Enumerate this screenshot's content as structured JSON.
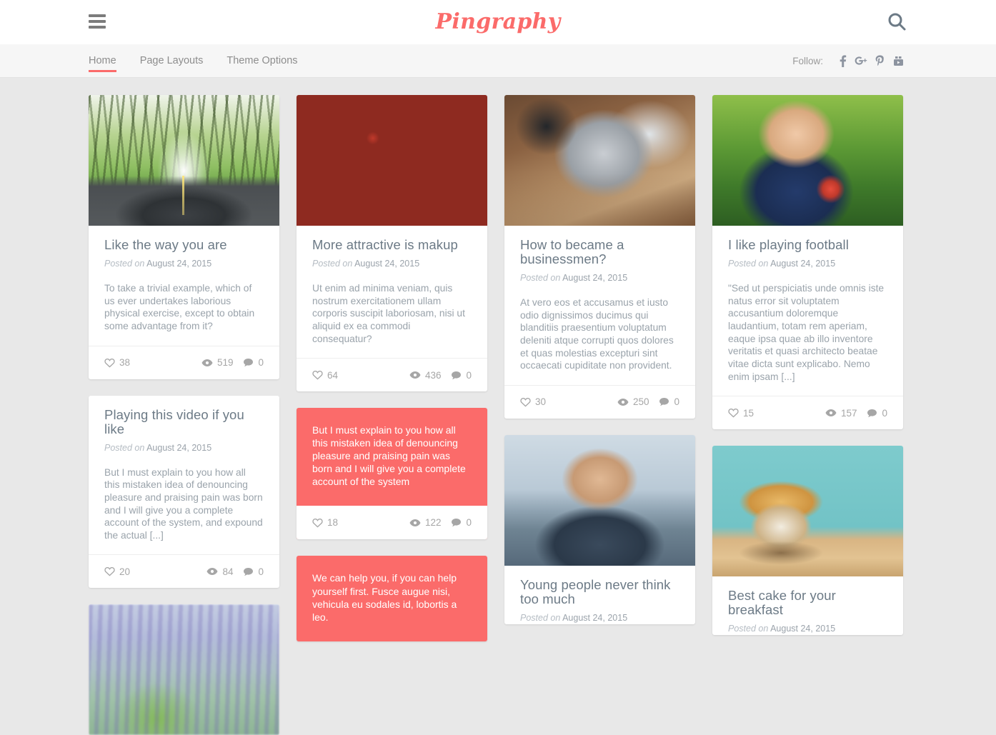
{
  "header": {
    "logo": "Pingraphy",
    "menu_icon": "hamburger-icon",
    "search_icon": "search-icon"
  },
  "nav": {
    "items": [
      {
        "label": "Home",
        "active": true
      },
      {
        "label": "Page Layouts",
        "active": false
      },
      {
        "label": "Theme Options",
        "active": false
      }
    ],
    "follow_label": "Follow:",
    "social": [
      {
        "name": "facebook-icon",
        "glyph": "f"
      },
      {
        "name": "google-plus-icon",
        "glyph": "g+"
      },
      {
        "name": "pinterest-icon",
        "glyph": "P"
      },
      {
        "name": "youtube-icon",
        "glyph": "▶"
      }
    ]
  },
  "meta_icons": {
    "likes": "heart-icon",
    "views": "eye-icon",
    "comments": "comment-icon"
  },
  "date_prefix": "Posted on",
  "colors": {
    "accent": "#fb6b6a",
    "page_background": "#e8e8e8",
    "card_background": "#ffffff",
    "title_text": "#6c7a86",
    "body_text": "#9aa3ab"
  },
  "columns": [
    {
      "cards": [
        {
          "type": "image",
          "image": "forest-road-photo",
          "title": "Like the way you are",
          "date": "August 24, 2015",
          "excerpt": "To take a trivial example, which of us ever undertakes laborious physical exercise, except to obtain some advantage from it?",
          "likes": "38",
          "views": "519",
          "comments": "0"
        },
        {
          "type": "text",
          "title": "Playing this video if you like",
          "date": "August 24, 2015",
          "excerpt": "But I must explain to you how all this mistaken idea of denouncing pleasure and praising pain was born and I will give you a complete account of the system, and expound the actual [...]",
          "likes": "20",
          "views": "84",
          "comments": "0"
        },
        {
          "type": "image-only",
          "image": "wisteria-blur-photo"
        }
      ]
    },
    {
      "cards": [
        {
          "type": "image",
          "image": "lipstick-mirror-photo",
          "title": "More attractive is makup",
          "date": "August 24, 2015",
          "excerpt": "Ut enim ad minima veniam, quis nostrum exercitationem ullam corporis suscipit laboriosam, nisi ut aliquid ex ea commodi consequatur?",
          "likes": "64",
          "views": "436",
          "comments": "0"
        },
        {
          "type": "quote",
          "quote": "But I must explain to you how all this mistaken idea of denouncing pleasure and praising pain was born and I will give you a complete account of the system",
          "likes": "18",
          "views": "122",
          "comments": "0"
        },
        {
          "type": "quote-partial",
          "quote": "We can help you, if you can help yourself first. Fusce augue nisi, vehicula eu sodales id, lobortis a leo."
        }
      ]
    },
    {
      "cards": [
        {
          "type": "image",
          "image": "office-laptop-photo",
          "title": "How to became a businessmen?",
          "date": "August 24, 2015",
          "excerpt": "At vero eos et accusamus et iusto odio dignissimos ducimus qui blanditiis praesentium voluptatum deleniti atque corrupti quos dolores et quas molestias excepturi sint occaecati cupiditate non provident.",
          "likes": "30",
          "views": "250",
          "comments": "0"
        },
        {
          "type": "image-partial",
          "image": "old-man-bridge-photo",
          "title": "Young people never think too much",
          "date": "August 24, 2015"
        }
      ]
    },
    {
      "cards": [
        {
          "type": "image",
          "image": "boy-football-photo",
          "title": "I like playing football",
          "date": "August 24, 2015",
          "excerpt": "\"Sed ut perspiciatis unde omnis iste natus error sit voluptatem accusantium doloremque laudantium, totam rem aperiam, eaque ipsa quae ab illo inventore veritatis et quasi architecto beatae vitae dicta sunt explicabo. Nemo enim ipsam [...]",
          "likes": "15",
          "views": "157",
          "comments": "0"
        },
        {
          "type": "image-partial",
          "image": "muffin-cake-photo",
          "title": "Best cake for your breakfast",
          "date": "August 24, 2015"
        }
      ]
    }
  ]
}
